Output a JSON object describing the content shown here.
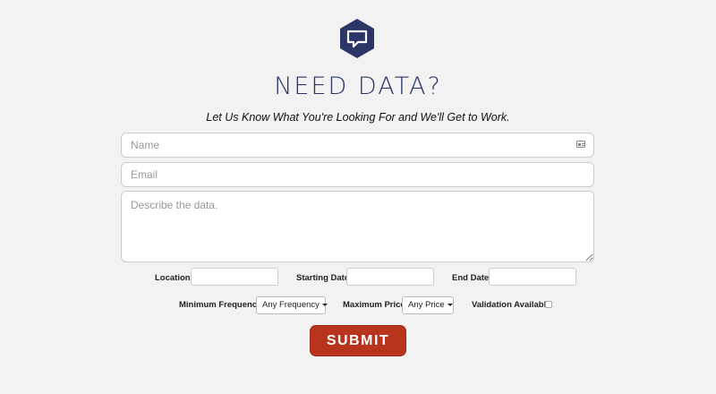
{
  "header": {
    "title": "NEED DATA?",
    "subtitle": "Let Us Know What You're Looking For and We'll Get to Work.",
    "logo_icon": "chat-bubble-hexagon-icon",
    "brand_color": "#2b3566"
  },
  "form": {
    "name": {
      "placeholder": "Name",
      "value": "",
      "icon": "contact-card-icon"
    },
    "email": {
      "placeholder": "Email",
      "value": ""
    },
    "description": {
      "placeholder": "Describe the data.",
      "value": ""
    },
    "location": {
      "label": "Location",
      "value": ""
    },
    "start_date": {
      "label": "Starting Date",
      "value": ""
    },
    "end_date": {
      "label": "End Date",
      "value": ""
    },
    "min_frequency": {
      "label": "Minimum Frequency",
      "selected": "Any Frequency"
    },
    "max_price": {
      "label": "Maximum Price",
      "selected": "Any Price"
    },
    "validation": {
      "label": "Validation Available",
      "checked": false
    },
    "submit_label": "SUBMIT",
    "submit_color": "#b8341c"
  }
}
